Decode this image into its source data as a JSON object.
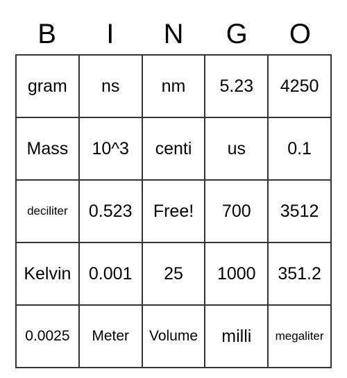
{
  "header": [
    "B",
    "I",
    "N",
    "G",
    "O"
  ],
  "grid": [
    [
      {
        "text": "gram",
        "size": "normal"
      },
      {
        "text": "ns",
        "size": "normal"
      },
      {
        "text": "nm",
        "size": "normal"
      },
      {
        "text": "5.23",
        "size": "normal"
      },
      {
        "text": "4250",
        "size": "normal"
      }
    ],
    [
      {
        "text": "Mass",
        "size": "normal"
      },
      {
        "text": "10^3",
        "size": "normal"
      },
      {
        "text": "centi",
        "size": "normal"
      },
      {
        "text": "us",
        "size": "normal"
      },
      {
        "text": "0.1",
        "size": "normal"
      }
    ],
    [
      {
        "text": "deciliter",
        "size": "small"
      },
      {
        "text": "0.523",
        "size": "normal"
      },
      {
        "text": "Free!",
        "size": "normal"
      },
      {
        "text": "700",
        "size": "normal"
      },
      {
        "text": "3512",
        "size": "normal"
      }
    ],
    [
      {
        "text": "Kelvin",
        "size": "normal"
      },
      {
        "text": "0.001",
        "size": "normal"
      },
      {
        "text": "25",
        "size": "normal"
      },
      {
        "text": "1000",
        "size": "normal"
      },
      {
        "text": "351.2",
        "size": "normal"
      }
    ],
    [
      {
        "text": "0.0025",
        "size": "medium"
      },
      {
        "text": "Meter",
        "size": "medium"
      },
      {
        "text": "Volume",
        "size": "medium"
      },
      {
        "text": "milli",
        "size": "normal"
      },
      {
        "text": "megaliter",
        "size": "small"
      }
    ]
  ]
}
